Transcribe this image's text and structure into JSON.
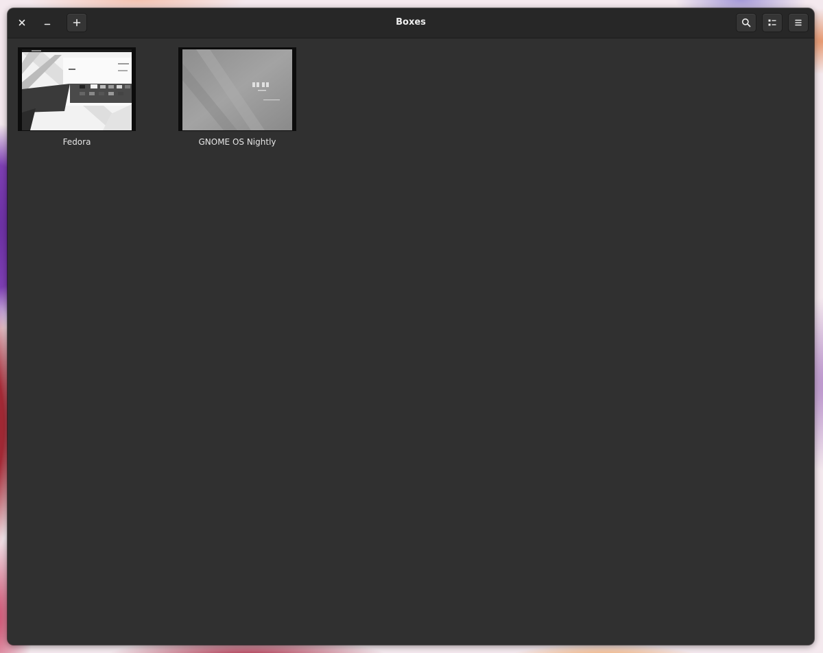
{
  "window": {
    "title": "Boxes"
  },
  "headerbar": {
    "close_icon": "close-icon",
    "minimize_icon": "minimize-icon",
    "new_icon": "plus-icon",
    "search_icon": "search-icon",
    "view_toggle_icon": "list-view-icon",
    "menu_icon": "hamburger-menu-icon"
  },
  "boxes": [
    {
      "name": "Fedora",
      "thumbnail_tone": "light"
    },
    {
      "name": "GNOME OS Nightly",
      "thumbnail_tone": "grey"
    }
  ],
  "colors": {
    "window_bg": "#303030",
    "headerbar_bg": "#272727",
    "text": "#eeeeee"
  }
}
